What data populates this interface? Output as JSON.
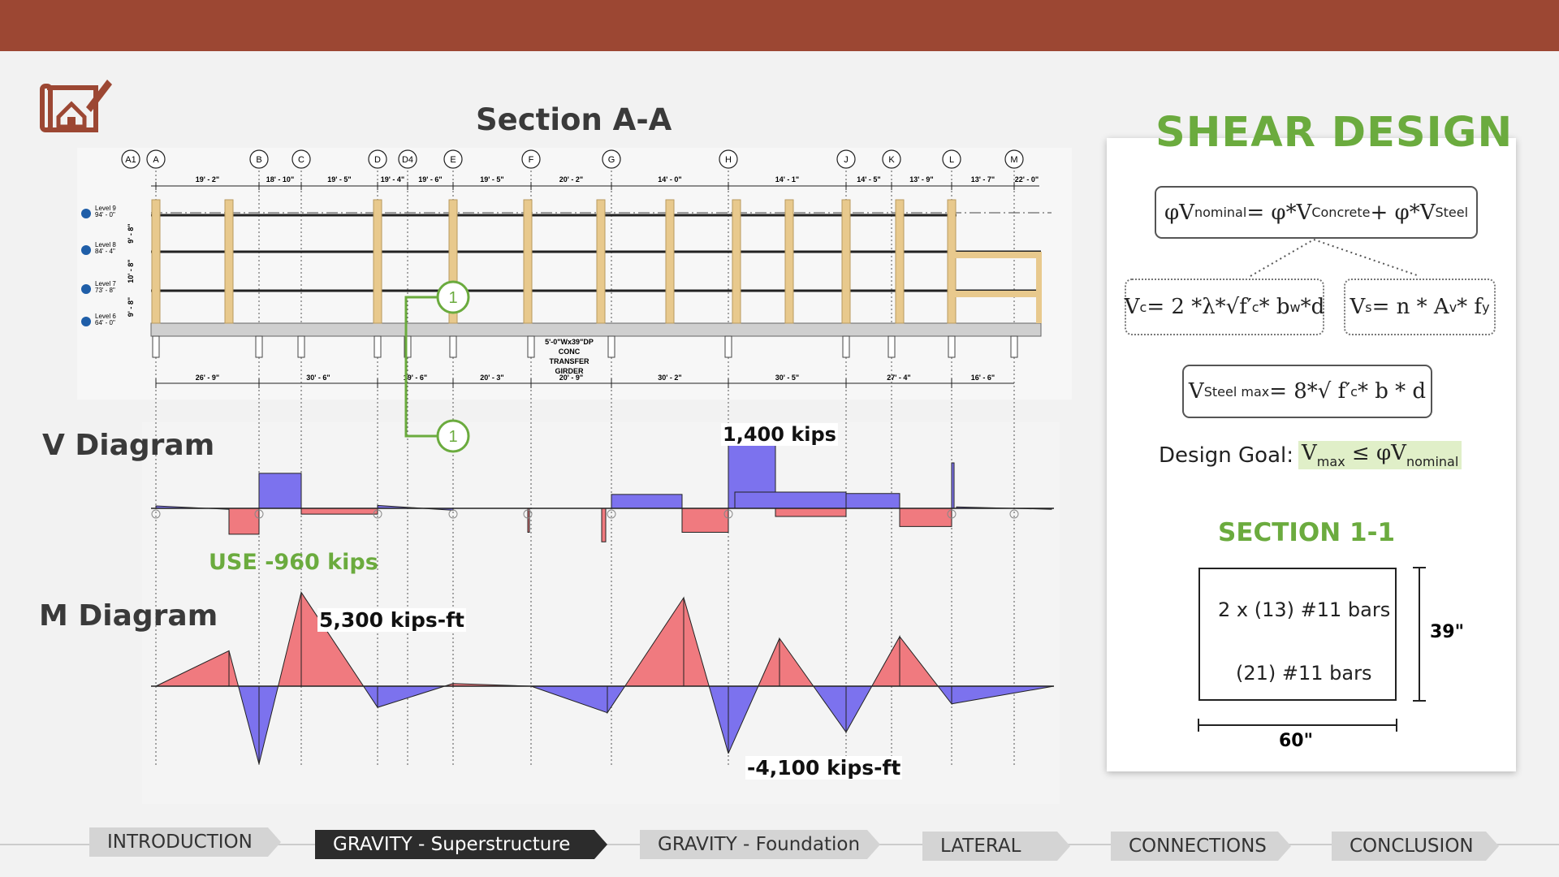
{
  "section_title": "Section A-A",
  "grid_lines": [
    "A1",
    "A",
    "B",
    "C",
    "D",
    "D4",
    "E",
    "F",
    "G",
    "H",
    "J",
    "K",
    "L",
    "M"
  ],
  "top_dims": [
    "19' - 2\"",
    "18' - 10\"",
    "19' - 5\"",
    "19' - 4\"",
    "19' - 6\"",
    "19' - 5\"",
    "20' - 2\"",
    "14' - 0\"",
    "14' - 1\"",
    "14' - 5\"",
    "13' - 9\"",
    "13' - 7\"",
    "22' - 0\""
  ],
  "bottom_dims": [
    "26' - 9\"",
    "30' - 6\"",
    "19' - 6\"",
    "20' - 3\"",
    "20' - 9\"",
    "30' - 2\"",
    "30' - 5\"",
    "27' - 4\"",
    "16' - 6\""
  ],
  "levels": [
    {
      "name": "Level 9",
      "elev": "94' - 0\""
    },
    {
      "name": "Level 8",
      "elev": "84' - 4\""
    },
    {
      "name": "Level 7",
      "elev": "73' - 8\""
    },
    {
      "name": "Level 6",
      "elev": "64' - 0\""
    }
  ],
  "story_heights": [
    "9' - 8\"",
    "10' - 8\"",
    "9' - 8\""
  ],
  "girder_note": "5'-0\"Wx39\"DP CONC TRANSFER GIRDER",
  "section_marker": "1",
  "v_title": "V Diagram",
  "m_title": "M Diagram",
  "v_max_label": "1,400 kips",
  "v_use_label": "USE -960 kips",
  "m_max_label": "5,300  kips-ft",
  "m_min_label": "-4,100  kips-ft",
  "shear_title": "SHEAR DESIGN",
  "eq_main": {
    "pre": "φV",
    "s1": "nominal",
    "mid": " = φ*V",
    "s2": "Concrete",
    "mid2": " + φ*V",
    "s3": "Steel"
  },
  "eq_vc": {
    "a": "V",
    "s1": "c",
    "b": " = 2 *λ*√f′",
    "s2": "c",
    "c": " * b",
    "s3": "w",
    "d": "*d"
  },
  "eq_vs": {
    "a": "V",
    "s1": "s",
    "b": " = n * A",
    "s2": "v",
    "c": " * f",
    "s3": "y"
  },
  "eq_vmax": {
    "a": "V",
    "s1": "Steel max",
    "b": " = 8*√ f′",
    "s2": "c",
    "c": "  * b * d"
  },
  "design_goal": {
    "label": "Design Goal:",
    "a": "V",
    "s1": "max",
    "b": " ≤ φV",
    "s2": "nominal"
  },
  "section11_title": "SECTION 1-1",
  "bars_top": "2 x (13) #11 bars",
  "bars_bottom": "(21) #11 bars",
  "dim_height": "39\"",
  "dim_width": "60\"",
  "nav": [
    {
      "label": "INTRODUCTION",
      "active": false
    },
    {
      "label": "GRAVITY - Superstructure",
      "active": true
    },
    {
      "label": "GRAVITY - Foundation",
      "active": false
    },
    {
      "label": "LATERAL",
      "active": false
    },
    {
      "label": "CONNECTIONS",
      "active": false
    },
    {
      "label": "CONCLUSION",
      "active": false
    }
  ],
  "colors": {
    "header": "#9c4733",
    "accent_green": "#6bab3e",
    "positive": "#f07a7f",
    "negative": "#7c72ee",
    "column": "#e8c98d"
  }
}
